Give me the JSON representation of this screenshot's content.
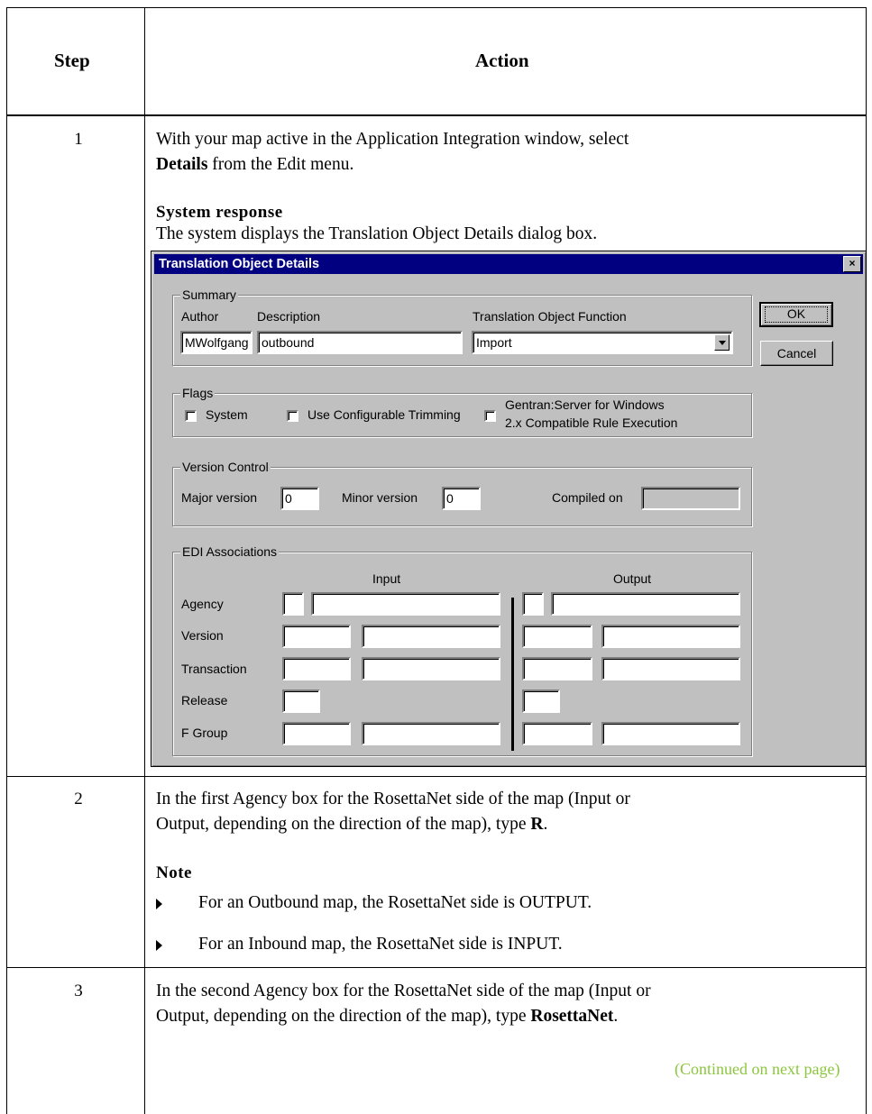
{
  "table": {
    "header_step": "Step",
    "header_action": "Action"
  },
  "steps": [
    {
      "number": "1",
      "line1": "With your map active in the Application Integration window, select",
      "line2_bold": "Details",
      "line2_rest": " from the Edit menu.",
      "subhead": "System response",
      "response": "The system displays the Translation Object Details dialog box."
    },
    {
      "number": "2",
      "line1": "In the first Agency box for the RosettaNet side of the map (Input or",
      "line2": "Output, depending on the direction of the map), type ",
      "line2_bold": "R",
      "line2_end": ".",
      "subhead": "Note",
      "bullets": [
        "For an Outbound map, the RosettaNet side is OUTPUT.",
        "For an Inbound map, the RosettaNet side is INPUT."
      ]
    },
    {
      "number": "3",
      "line1": "In the second Agency box for the RosettaNet side of the map (Input or",
      "line2": "Output, depending on the direction of the map), type ",
      "line2_bold": "RosettaNet",
      "line2_end": "."
    }
  ],
  "continued": "(Continued on next page)",
  "dialog": {
    "title": "Translation Object Details",
    "close_glyph": "×",
    "ok": "OK",
    "cancel": "Cancel",
    "summary": {
      "group": "Summary",
      "author_label": "Author",
      "author_value": "MWolfgang",
      "description_label": "Description",
      "description_value": "outbound",
      "function_label": "Translation Object Function",
      "function_value": "Import"
    },
    "flags": {
      "group": "Flags",
      "system": "System",
      "trimming": "Use Configurable Trimming",
      "gentran_line1": "Gentran:Server for Windows",
      "gentran_line2": "2.x Compatible Rule Execution"
    },
    "version_control": {
      "group": "Version Control",
      "major_label": "Major version",
      "major_value": "0",
      "minor_label": "Minor version",
      "minor_value": "0",
      "compiled_label": "Compiled on",
      "compiled_value": ""
    },
    "edi": {
      "group": "EDI Associations",
      "input": "Input",
      "output": "Output",
      "rows": [
        "Agency",
        "Version",
        "Transaction",
        "Release",
        "F Group"
      ]
    }
  }
}
